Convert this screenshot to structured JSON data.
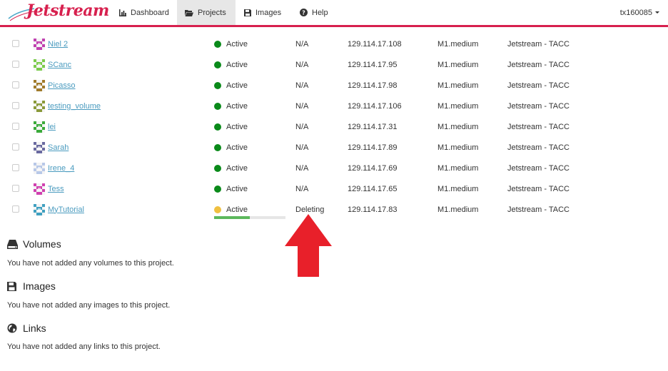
{
  "brand": {
    "name": "Jetstream",
    "color": "#d7204e"
  },
  "nav": {
    "dashboard": "Dashboard",
    "projects": "Projects",
    "images": "Images",
    "help": "Help",
    "user": "tx160085"
  },
  "instances": [
    {
      "name": "Niel 2",
      "status": "Active",
      "activity": "N/A",
      "ip": "129.114.17.108",
      "size": "M1.medium",
      "provider": "Jetstream - TACC",
      "status_color": "#0a8a1a",
      "avatar_color": "#c040b0"
    },
    {
      "name": "SCanc",
      "status": "Active",
      "activity": "N/A",
      "ip": "129.114.17.95",
      "size": "M1.medium",
      "provider": "Jetstream - TACC",
      "status_color": "#0a8a1a",
      "avatar_color": "#7acb4a"
    },
    {
      "name": "Picasso",
      "status": "Active",
      "activity": "N/A",
      "ip": "129.114.17.98",
      "size": "M1.medium",
      "provider": "Jetstream - TACC",
      "status_color": "#0a8a1a",
      "avatar_color": "#a07a2a"
    },
    {
      "name": "testing_volume",
      "status": "Active",
      "activity": "N/A",
      "ip": "129.114.17.106",
      "size": "M1.medium",
      "provider": "Jetstream - TACC",
      "status_color": "#0a8a1a",
      "avatar_color": "#8a9a3a"
    },
    {
      "name": "lei",
      "status": "Active",
      "activity": "N/A",
      "ip": "129.114.17.31",
      "size": "M1.medium",
      "provider": "Jetstream - TACC",
      "status_color": "#0a8a1a",
      "avatar_color": "#3aaa3a"
    },
    {
      "name": "Sarah",
      "status": "Active",
      "activity": "N/A",
      "ip": "129.114.17.89",
      "size": "M1.medium",
      "provider": "Jetstream - TACC",
      "status_color": "#0a8a1a",
      "avatar_color": "#6a6aa0"
    },
    {
      "name": "Irene_4",
      "status": "Active",
      "activity": "N/A",
      "ip": "129.114.17.69",
      "size": "M1.medium",
      "provider": "Jetstream - TACC",
      "status_color": "#0a8a1a",
      "avatar_color": "#b8c8e8"
    },
    {
      "name": "Tess",
      "status": "Active",
      "activity": "N/A",
      "ip": "129.114.17.65",
      "size": "M1.medium",
      "provider": "Jetstream - TACC",
      "status_color": "#0a8a1a",
      "avatar_color": "#d040b0"
    },
    {
      "name": "MyTutorial",
      "status": "Active",
      "activity": "Deleting",
      "ip": "129.114.17.83",
      "size": "M1.medium",
      "provider": "Jetstream - TACC",
      "status_color": "#f0c040",
      "avatar_color": "#40a0c0",
      "progress": 0.5
    }
  ],
  "volumes": {
    "title": "Volumes",
    "empty": "You have not added any volumes to this project."
  },
  "images": {
    "title": "Images",
    "empty": "You have not added any images to this project."
  },
  "links": {
    "title": "Links",
    "empty": "You have not added any links to this project."
  },
  "annotation": {
    "arrow_color": "#e8202a"
  }
}
